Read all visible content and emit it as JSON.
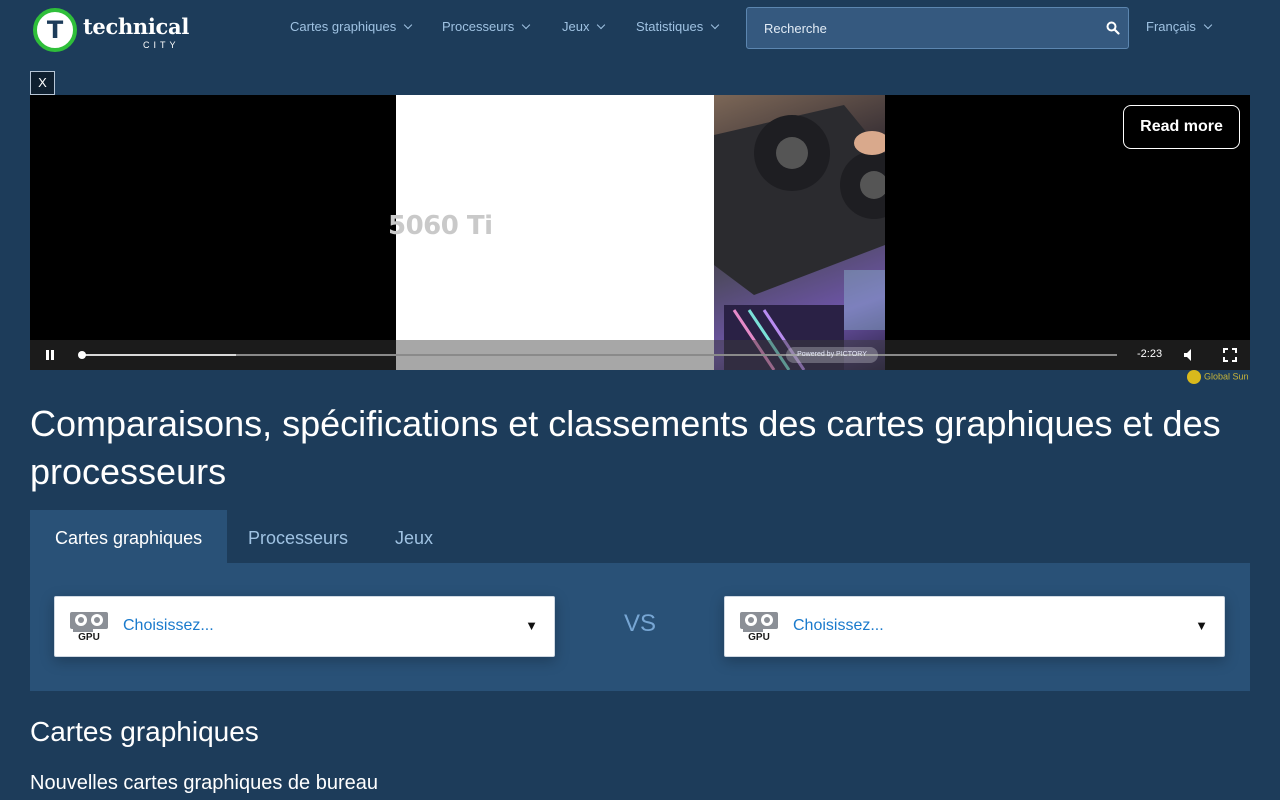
{
  "header": {
    "logo_text": "technical",
    "logo_sub": "CITY",
    "logo_letter": "T",
    "nav": [
      {
        "label": "Cartes graphiques"
      },
      {
        "label": "Processeurs"
      },
      {
        "label": "Jeux"
      },
      {
        "label": "Statistiques"
      }
    ],
    "search": {
      "placeholder": "Recherche",
      "icon": "search-icon"
    },
    "language": "Français"
  },
  "ad": {
    "close_label": "X",
    "caption": "5060 Ti",
    "read_more": "Read more",
    "time_remaining": "-2:23",
    "playback_fraction": 0.0,
    "buffered_fraction": 0.15,
    "badge_text": "Powered by PICTORY",
    "brand": "Global Sun"
  },
  "main": {
    "title": "Comparaisons, spécifications et classements des cartes graphiques et des processeurs",
    "tabs": [
      {
        "label": "Cartes graphiques",
        "active": true
      },
      {
        "label": "Processeurs",
        "active": false
      },
      {
        "label": "Jeux",
        "active": false
      }
    ],
    "compare": {
      "left": {
        "icon_label": "GPU",
        "text": "Choisissez..."
      },
      "vs": "VS",
      "right": {
        "icon_label": "GPU",
        "text": "Choisissez..."
      }
    },
    "section_title": "Cartes graphiques",
    "section_sub": "Nouvelles cartes graphiques de bureau"
  },
  "colors": {
    "background": "#1d3c5a",
    "panel": "#295177",
    "link": "#9fc2e2",
    "accent_green": "#2fbf3a",
    "select_text": "#1a7acc"
  }
}
